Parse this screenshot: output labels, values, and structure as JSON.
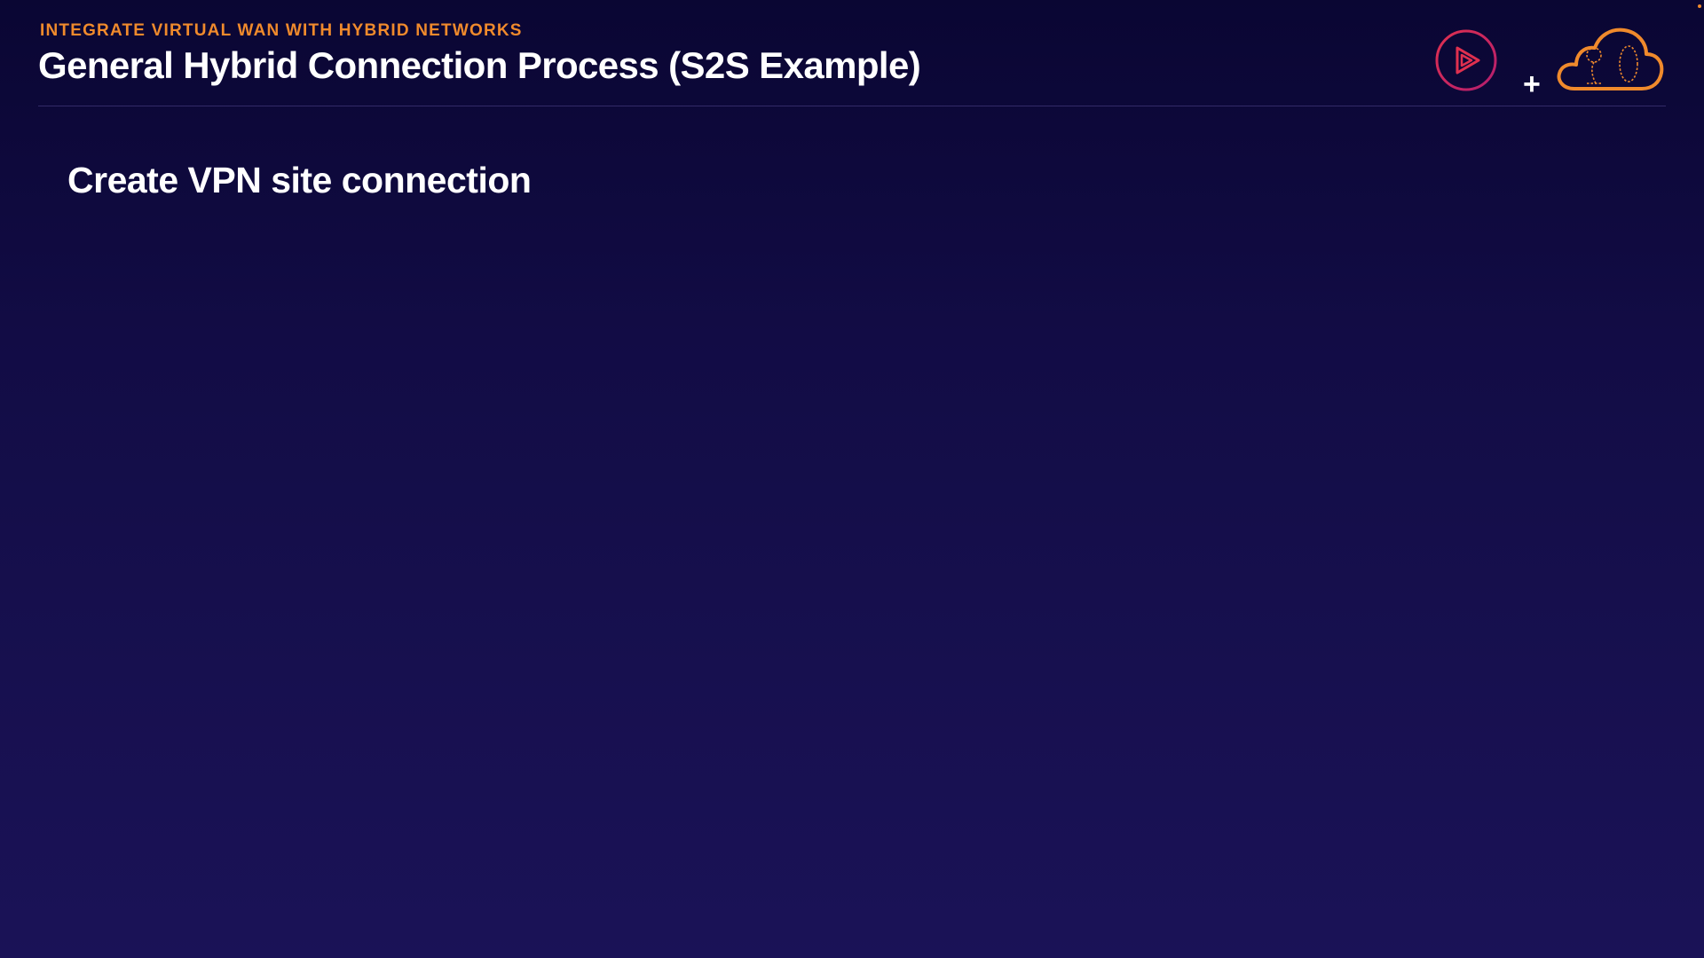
{
  "header": {
    "eyebrow": "INTEGRATE VIRTUAL WAN WITH HYBRID NETWORKS",
    "title": "General Hybrid Connection Process (S2S Example)",
    "plus": "+"
  },
  "content": {
    "subtitle": "Create VPN site connection"
  },
  "icons": {
    "play": "pluralsight-play-logo-icon",
    "cloud": "cloud-azure-logo-icon"
  },
  "colors": {
    "accent_orange": "#f08a2c",
    "accent_pink": "#e0304f",
    "background_top": "#0a0633",
    "background_bottom": "#1a1257",
    "text": "#ffffff"
  }
}
